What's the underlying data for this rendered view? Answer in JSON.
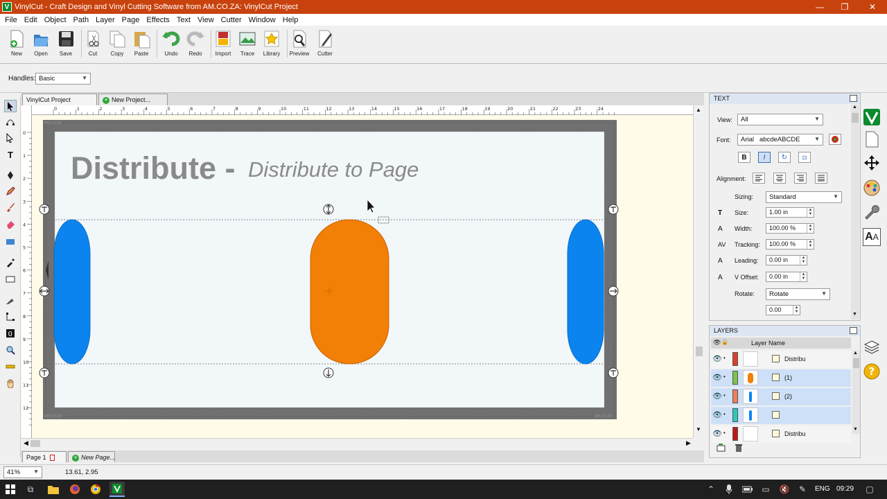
{
  "window": {
    "title": "VinylCut - Craft Design and Vinyl Cutting Software from AM.CO.ZA: VinylCut Project",
    "app_icon": "V",
    "minimize": "—",
    "maximize": "❐",
    "close": "✕"
  },
  "menu": [
    "File",
    "Edit",
    "Object",
    "Path",
    "Layer",
    "Page",
    "Effects",
    "Text",
    "View",
    "Cutter",
    "Window",
    "Help"
  ],
  "toolbar": {
    "new": "New",
    "open": "Open",
    "save": "Save",
    "cut": "Cut",
    "copy": "Copy",
    "paste": "Paste",
    "undo": "Undo",
    "redo": "Redo",
    "import": "Import",
    "trace": "Trace",
    "library": "Library",
    "preview": "Preview",
    "cutter": "Cutter"
  },
  "handles": {
    "label": "Handles:",
    "value": "Basic"
  },
  "doc_tabs": {
    "active": "VinylCut Project",
    "new": "New Project..."
  },
  "ruler": {
    "h": [
      "0",
      "1",
      "2",
      "3",
      "4",
      "5",
      "6",
      "7",
      "8",
      "9",
      "10",
      "11",
      "12",
      "13",
      "14",
      "15",
      "16",
      "17",
      "18",
      "19",
      "20",
      "21",
      "22",
      "23",
      "24"
    ],
    "v": [
      "0",
      "1",
      "2",
      "3",
      "4",
      "5",
      "6",
      "7",
      "8",
      "9",
      "10",
      "11",
      "12"
    ]
  },
  "canvas": {
    "heading_bold": "Distribute -",
    "heading_italic": "Distribute to Page",
    "watermark": "AM.CO.ZA",
    "colors": {
      "blue": "#0b84f0",
      "orange": "#f27f06"
    }
  },
  "page_tabs": {
    "active": "Page 1",
    "new": "New Page..."
  },
  "status": {
    "zoom": "41%",
    "coords": "13.61, 2.95"
  },
  "text_panel": {
    "title": "TEXT",
    "view_label": "View:",
    "view_value": "All",
    "font_label": "Font:",
    "font_value": "Arial",
    "font_sample": "abcdeABCDE",
    "bold": "B",
    "italic": "I",
    "alignment_label": "Alignment:",
    "sizing_label": "Sizing:",
    "sizing_value": "Standard",
    "size_label": "Size:",
    "size_value": "1.00 in",
    "width_label": "Width:",
    "width_value": "100.00 %",
    "tracking_label": "Tracking:",
    "tracking_value": "100.00 %",
    "leading_label": "Leading:",
    "leading_value": "0.00 in",
    "voffset_label": "V Offset:",
    "voffset_value": "0.00 in",
    "rotate_label": "Rotate:",
    "rotate_value": "Rotate",
    "rotate_angle": "0.00"
  },
  "layers_panel": {
    "title": "LAYERS",
    "col_header": "Layer Name",
    "rows": [
      {
        "name": "Distribu",
        "color": "#d9412b",
        "thumb": "none",
        "selected": false
      },
      {
        "name": "(1)",
        "color": "#7fc24e",
        "thumb": "orange",
        "selected": true
      },
      {
        "name": "(2)",
        "color": "#f0805a",
        "thumb": "blue",
        "selected": true
      },
      {
        "name": "",
        "color": "#2ec9b8",
        "thumb": "blue",
        "selected": true
      },
      {
        "name": "Distribu",
        "color": "#c01818",
        "thumb": "none",
        "selected": false
      }
    ]
  },
  "taskbar": {
    "lang": "ENG",
    "time": "09:29"
  }
}
